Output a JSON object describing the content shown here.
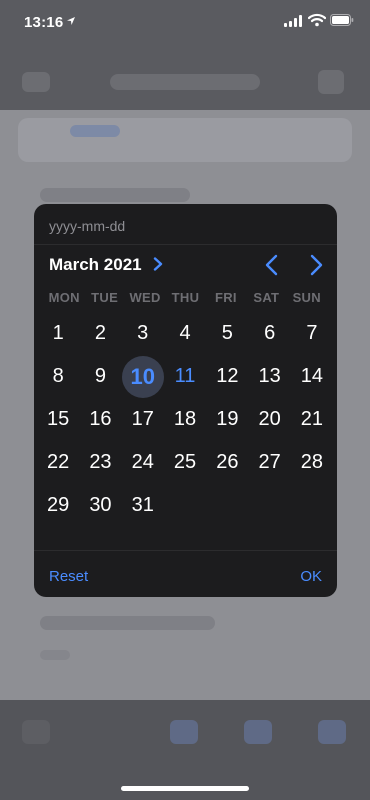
{
  "status_bar": {
    "time": "13:16",
    "location_icon": "location-arrow-icon",
    "icons": [
      "cellular-signal-icon",
      "wifi-icon",
      "battery-icon"
    ]
  },
  "picker": {
    "format_placeholder": "yyyy-mm-dd",
    "month_label": "March 2021",
    "weekdays": [
      "MON",
      "TUE",
      "WED",
      "THU",
      "FRI",
      "SAT",
      "SUN"
    ],
    "weeks": [
      [
        "1",
        "2",
        "3",
        "4",
        "5",
        "6",
        "7"
      ],
      [
        "8",
        "9",
        "10",
        "11",
        "12",
        "13",
        "14"
      ],
      [
        "15",
        "16",
        "17",
        "18",
        "19",
        "20",
        "21"
      ],
      [
        "22",
        "23",
        "24",
        "25",
        "26",
        "27",
        "28"
      ],
      [
        "29",
        "30",
        "31",
        "",
        "",
        "",
        ""
      ]
    ],
    "selected_day": "10",
    "highlighted_day": "11",
    "reset_label": "Reset",
    "ok_label": "OK"
  },
  "colors": {
    "accent": "#4a8cff",
    "panel": "#1c1c1e",
    "selected_circle": "#3a4050"
  }
}
